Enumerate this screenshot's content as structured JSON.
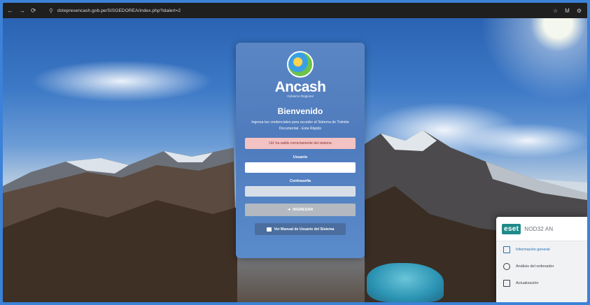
{
  "browser": {
    "url": "dstepresencash.gob.pe/SISGEDOREA/index.php?idalert=2",
    "nav": {
      "back": "←",
      "forward": "→",
      "reload": "⟳"
    },
    "right_icons": [
      "☆",
      "M",
      "⚙"
    ]
  },
  "login": {
    "logo_title": "Ancash",
    "logo_subtitle": "Gobierno Regional",
    "welcome": "Bienvenido",
    "description": "Ingresa tus credenciales para acceder al Sistema de Trámite Documental - Esta Rápido",
    "alert": "Ud. ha salido correctamente del sistema",
    "user_label": "Usuario",
    "user_value": "",
    "password_label": "Contraseña",
    "password_value": "",
    "login_button": "INGRESAR",
    "manual_button": "Ver Manual de Usuario del Sistema"
  },
  "eset": {
    "logo": "eset",
    "product": "NOD32 AN",
    "items": [
      {
        "icon": "dashboard-icon",
        "label": "Información general"
      },
      {
        "icon": "search-icon",
        "label": "Análisis del ordenador"
      },
      {
        "icon": "update-icon",
        "label": "Actualización"
      }
    ]
  },
  "colors": {
    "card": "#4f7bbd",
    "alert_bg": "#f3c3c3",
    "login_button": "#b3b9c0",
    "manual_button": "#4b6e9f",
    "eset_accent": "#1f8a8a"
  }
}
